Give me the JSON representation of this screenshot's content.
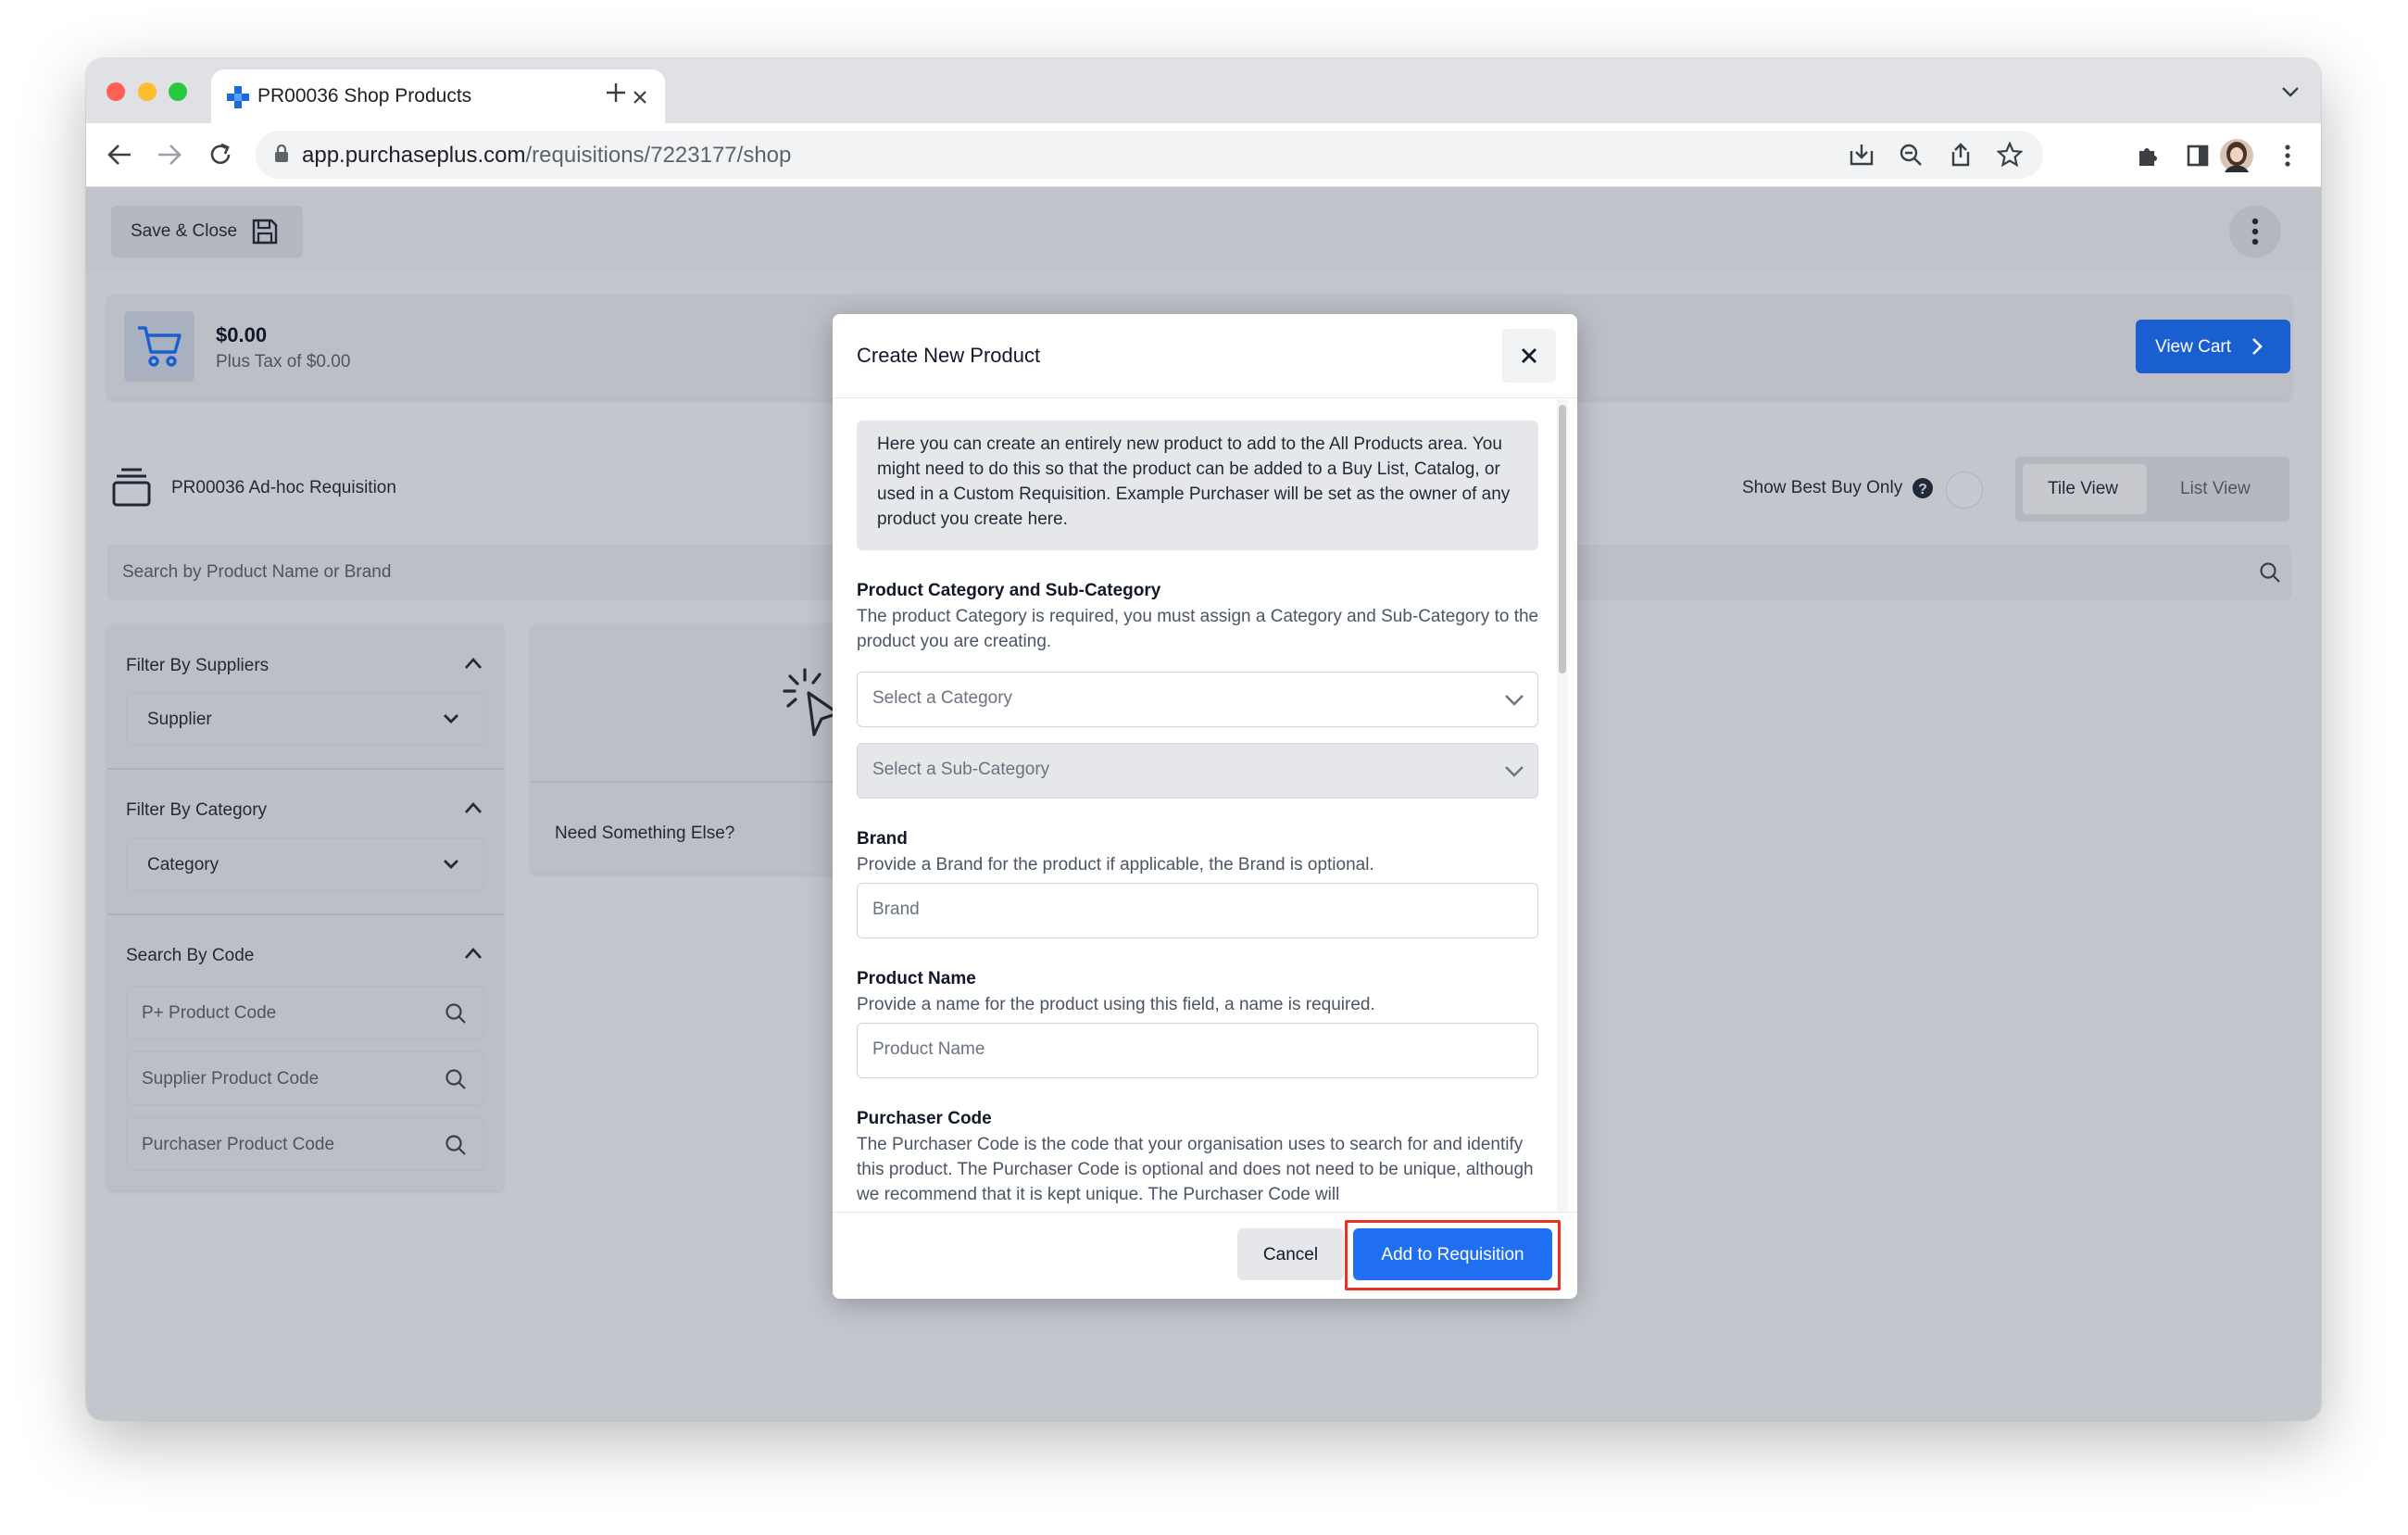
{
  "browser": {
    "tab_title": "PR00036 Shop Products",
    "url_domain": "app.purchaseplus.com",
    "url_path": "/requisitions/7223177/shop"
  },
  "app": {
    "save_close_label": "Save & Close",
    "cart_total": "$0.00",
    "cart_tax": "Plus Tax of $0.00",
    "view_cart_label": "View Cart",
    "requisition_title": "PR00036 Ad-hoc Requisition",
    "best_buy_label": "Show Best Buy Only",
    "tile_view_label": "Tile View",
    "list_view_label": "List View",
    "search_placeholder": "Search by Product Name or Brand",
    "filters": {
      "suppliers_heading": "Filter By Suppliers",
      "supplier_select": "Supplier",
      "category_heading": "Filter By Category",
      "category_select": "Category",
      "code_heading": "Search By Code",
      "pplus_code": "P+ Product Code",
      "supplier_code": "Supplier Product Code",
      "purchaser_code": "Purchaser Product Code"
    },
    "need_something_label": "Need Something Else?"
  },
  "modal": {
    "title": "Create New Product",
    "intro": "Here you can create an entirely new product to add to the All Products area. You might need to do this so that the product can be added to a Buy List, Catalog, or used in a Custom Requisition. Example Purchaser will be set as the owner of any product you create here.",
    "category_label": "Product Category and Sub-Category",
    "category_help": "The product Category is required, you must assign a Category and Sub-Category to the product you are creating.",
    "category_placeholder": "Select a Category",
    "subcategory_placeholder": "Select a Sub-Category",
    "brand_label": "Brand",
    "brand_help": "Provide a Brand for the product if applicable, the Brand is optional.",
    "brand_placeholder": "Brand",
    "name_label": "Product Name",
    "name_help": "Provide a name for the product using this field, a name is required.",
    "name_placeholder": "Product Name",
    "purchaser_code_label": "Purchaser Code",
    "purchaser_code_help": "The Purchaser Code is the code that your organisation uses to search for and identify this product. The Purchaser Code is optional and does not need to be unique, although we recommend that it is kept unique. The Purchaser Code will",
    "cancel_label": "Cancel",
    "add_label": "Add to Requisition"
  },
  "colors": {
    "primary_blue": "#1a6ae0",
    "highlight_red": "#e53222",
    "overlay_gray": "#c3c6cd"
  }
}
